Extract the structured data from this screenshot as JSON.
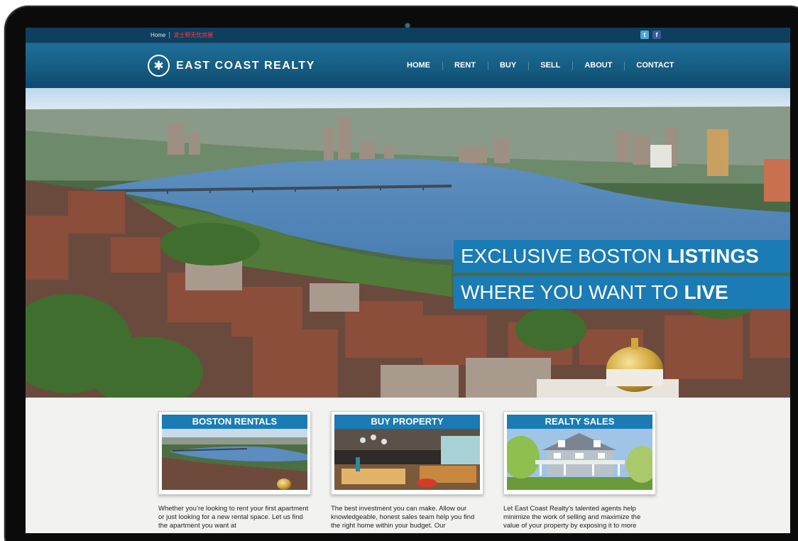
{
  "topbar": {
    "home": "Home",
    "chinese_link": "波士顿无忧房屋",
    "social": [
      {
        "name": "twitter",
        "glyph": "t"
      },
      {
        "name": "facebook",
        "glyph": "f"
      }
    ]
  },
  "logo": {
    "glyph": "✱",
    "text": "EAST COAST REALTY"
  },
  "nav": [
    {
      "label": "HOME"
    },
    {
      "label": "RENT"
    },
    {
      "label": "BUY"
    },
    {
      "label": "SELL"
    },
    {
      "label": "ABOUT"
    },
    {
      "label": "CONTACT"
    }
  ],
  "hero": {
    "line1_regular": "EXCLUSIVE BOSTON",
    "line1_bold": "LISTINGS",
    "line2_regular": "WHERE YOU WANT TO",
    "line2_bold": "LIVE"
  },
  "cards": [
    {
      "title": "BOSTON RENTALS",
      "desc": "Whether you’re looking to rent your first apartment or just looking for a new rental space. Let us find the apartment you want at"
    },
    {
      "title": "BUY PROPERTY",
      "desc": "The best investment you can make. Allow our knowledgeable, honest sales team help you find the right home within your budget. Our"
    },
    {
      "title": "REALTY SALES",
      "desc": "Let East Coast Realty’s talented agents help minimize the work of selling and maximize the value of your property by exposing it to more"
    }
  ],
  "colors": {
    "accent": "#1a7bb5",
    "nav_bg": "#165c82",
    "topbar_bg": "#0f3f5f",
    "chinese_link": "#ff3b3b"
  }
}
